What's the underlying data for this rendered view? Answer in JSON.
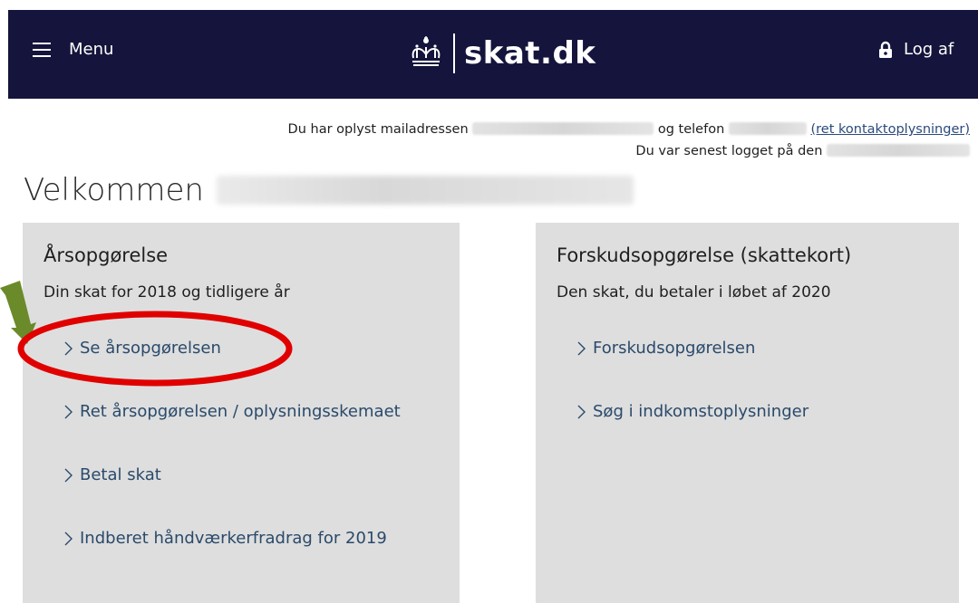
{
  "header": {
    "menu_label": "Menu",
    "logo_text": "skat.dk",
    "logout_label": "Log af",
    "bg_color": "#14143c"
  },
  "contact": {
    "email_prefix": "Du har oplyst mailadressen",
    "phone_prefix": "og telefon",
    "edit_link": "(ret kontaktoplysninger)",
    "last_login_prefix": "Du var senest logget på den"
  },
  "welcome": {
    "title": "Velkommen"
  },
  "panels": {
    "left": {
      "title": "Årsopgørelse",
      "subtitle": "Din skat for 2018 og tidligere år",
      "links": [
        "Se årsopgørelsen",
        "Ret årsopgørelsen / oplysningsskemaet",
        "Betal skat",
        "Indberet håndværkerfradrag for 2019"
      ]
    },
    "right": {
      "title": "Forskudsopgørelse (skattekort)",
      "subtitle": "Den skat, du betaler i løbet af 2020",
      "links": [
        "Forskudsopgørelsen",
        "Søg i indkomstoplysninger"
      ]
    }
  },
  "annotations": {
    "highlight_color": "#e00000",
    "arrow_color": "#6b8a2a"
  }
}
